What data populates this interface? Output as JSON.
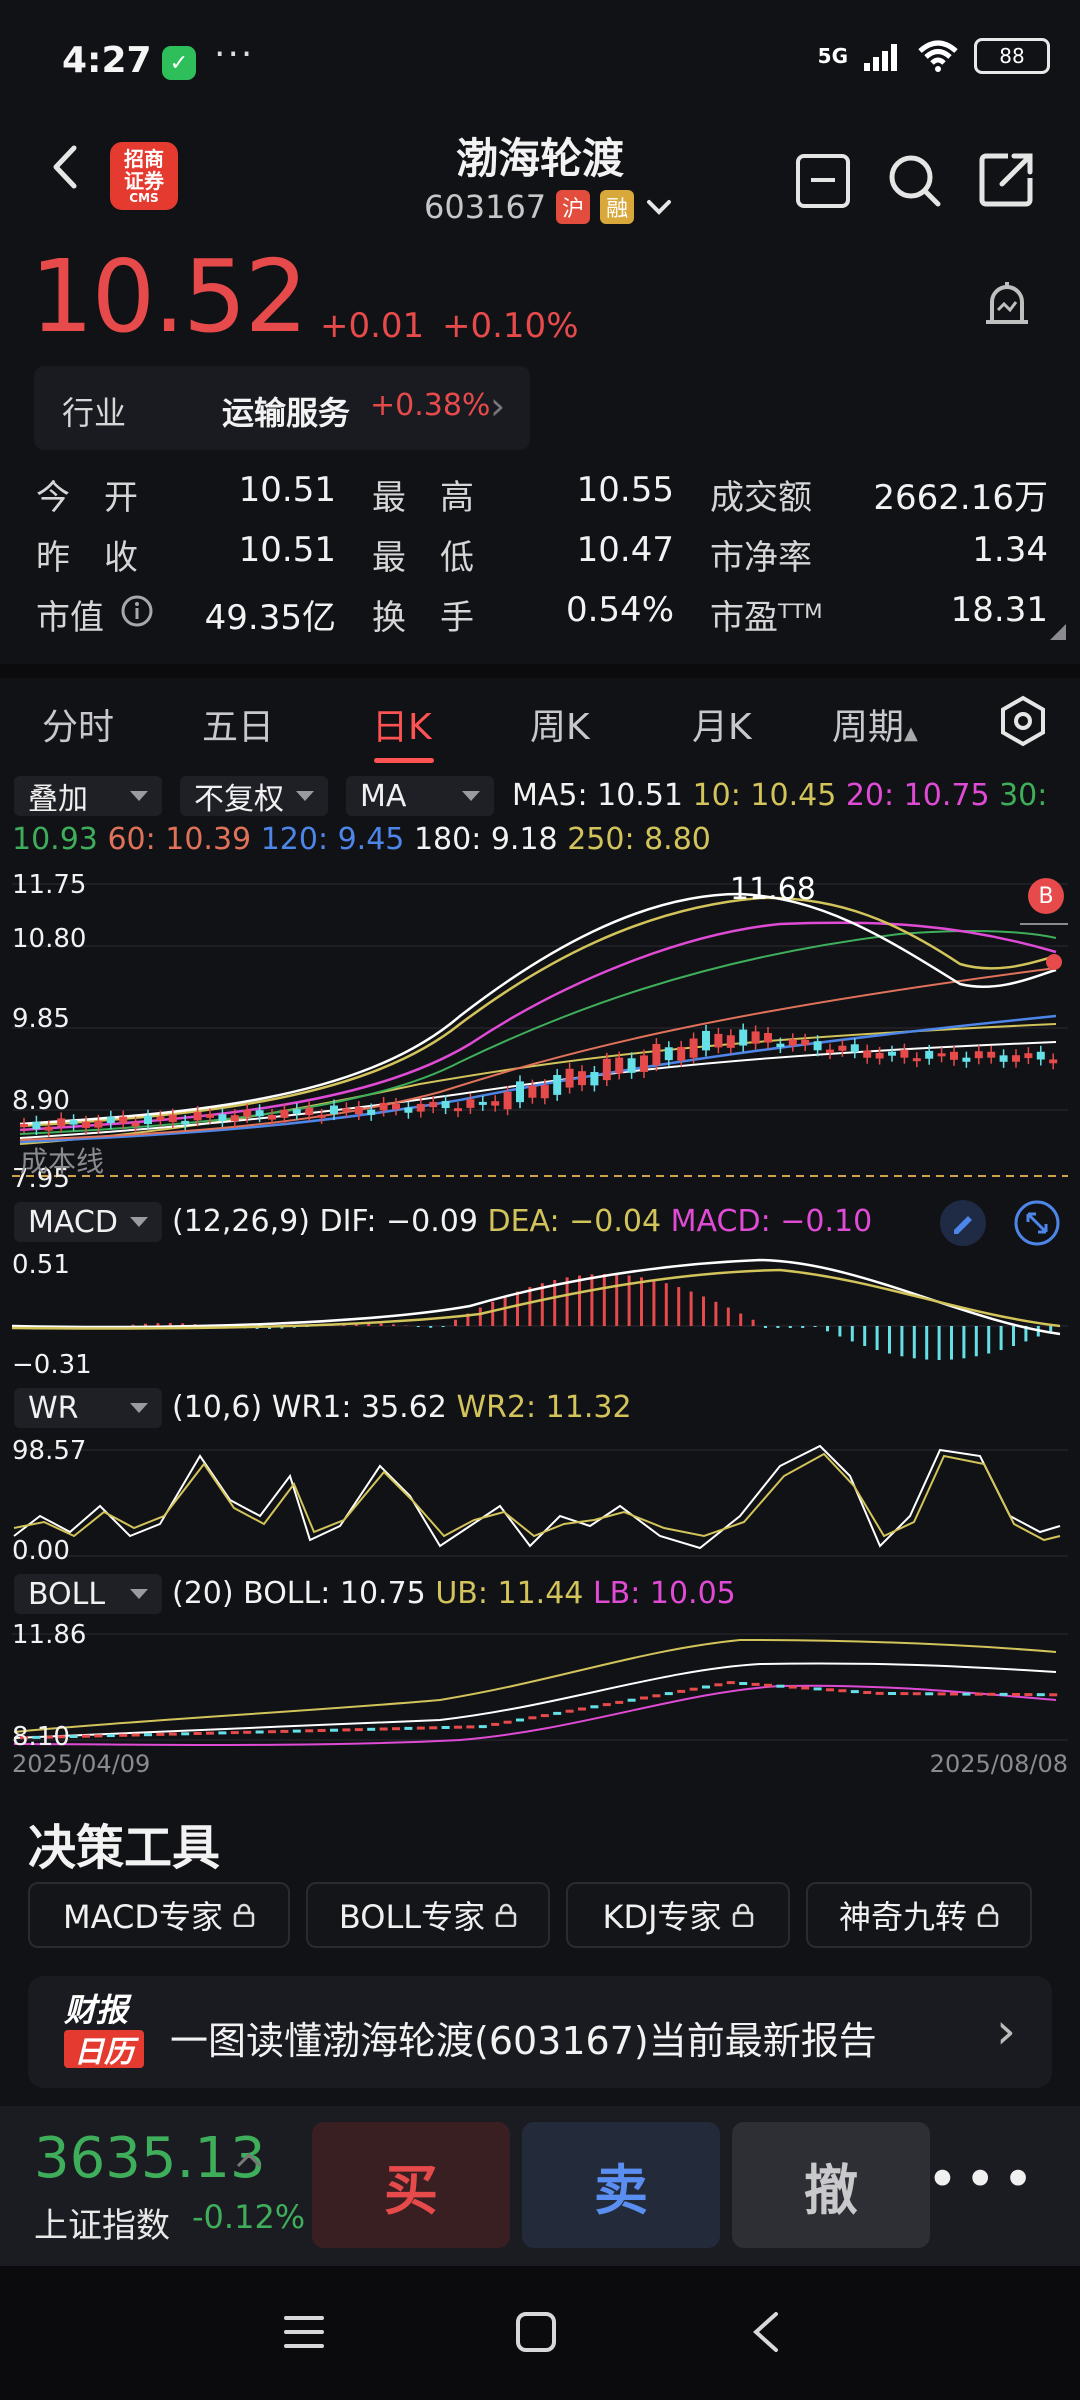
{
  "status_bar": {
    "time": "4:27",
    "more": "···",
    "signal": "5G",
    "battery": "88"
  },
  "header": {
    "logo_text_1": "招商",
    "logo_text_2": "证券",
    "logo_text_3": "CMS",
    "title": "渤海轮渡",
    "code": "603167",
    "tag_hu": "沪",
    "tag_rong": "融"
  },
  "quote": {
    "price": "10.52",
    "change": "+0.01",
    "change_pct": "+0.10%",
    "industry_label": "行业",
    "industry_value": "运输服务",
    "industry_change": "+0.38%"
  },
  "stats": [
    {
      "k1": "今　开",
      "v1": "10.51",
      "k2": "最　高",
      "v2": "10.55",
      "k3": "成交额",
      "v3": "2662.16万"
    },
    {
      "k1": "昨　收",
      "v1": "10.51",
      "k2": "最　低",
      "v2": "10.47",
      "k3": "市净率",
      "v3": "1.34"
    },
    {
      "k1": "市值",
      "v1": "49.35亿",
      "k2": "换　手",
      "v2": "0.54%",
      "k3": "市盈ᵀᵀᴹ",
      "v3": "18.31"
    }
  ],
  "tabs": [
    "分时",
    "五日",
    "日K",
    "周K",
    "月K",
    "周期"
  ],
  "toolbar": {
    "overlay": "叠加",
    "adjust": "不复权",
    "indicator": "MA",
    "ma5": "MA5: 10.51",
    "ma10": "10: 10.45",
    "ma20": "20: 10.75",
    "ma30_label": "30:",
    "ma30_val": "10.93",
    "ma60": "60: 10.39",
    "ma120": "120: 9.45",
    "ma180": "180: 9.18",
    "ma250": "250: 8.80"
  },
  "main_chart": {
    "y_top": "11.75",
    "y_2": "10.80",
    "y_3": "9.85",
    "y_4": "8.90",
    "y_5": "7.95",
    "high_label": "11.68",
    "cost_line": "成本线",
    "b_marker": "B"
  },
  "macd": {
    "name": "MACD",
    "params": "(12,26,9)",
    "dif": "DIF: −0.09",
    "dea": "DEA: −0.04",
    "macd": "MACD: −0.10",
    "y_top": "0.51",
    "y_bottom": "−0.31"
  },
  "wr": {
    "name": "WR",
    "params": "(10,6)",
    "wr1": "WR1: 35.62",
    "wr2": "WR2: 11.32",
    "y_top": "98.57",
    "y_bottom": "0.00"
  },
  "boll": {
    "name": "BOLL",
    "params": "(20)",
    "boll": "BOLL: 10.75",
    "ub": "UB: 11.44",
    "lb": "LB: 10.05",
    "y_top": "11.86",
    "y_bottom": "8.10",
    "date_start": "2025/04/09",
    "date_end": "2025/08/08"
  },
  "decision": {
    "title": "决策工具",
    "tools": [
      "MACD专家",
      "BOLL专家",
      "KDJ专家",
      "神奇九转"
    ]
  },
  "report": {
    "badge_1": "财报",
    "badge_2": "日历",
    "text": "一图读懂渤海轮渡(603167)当前最新报告"
  },
  "trade": {
    "index_value": "3635.13",
    "index_name": "上证指数",
    "index_pct": "-0.12%",
    "buy": "买",
    "sell": "卖",
    "cancel": "撤",
    "more": "•••"
  },
  "colors": {
    "up": "#e64a4a",
    "down": "#3fae5b",
    "ma5": "#ffffff",
    "ma10": "#d2c35a",
    "ma20": "#e04bd6",
    "ma30": "#3fae5b",
    "ma60": "#e0725a",
    "ma120": "#4d86e8",
    "ma250": "#d2c35a"
  }
}
